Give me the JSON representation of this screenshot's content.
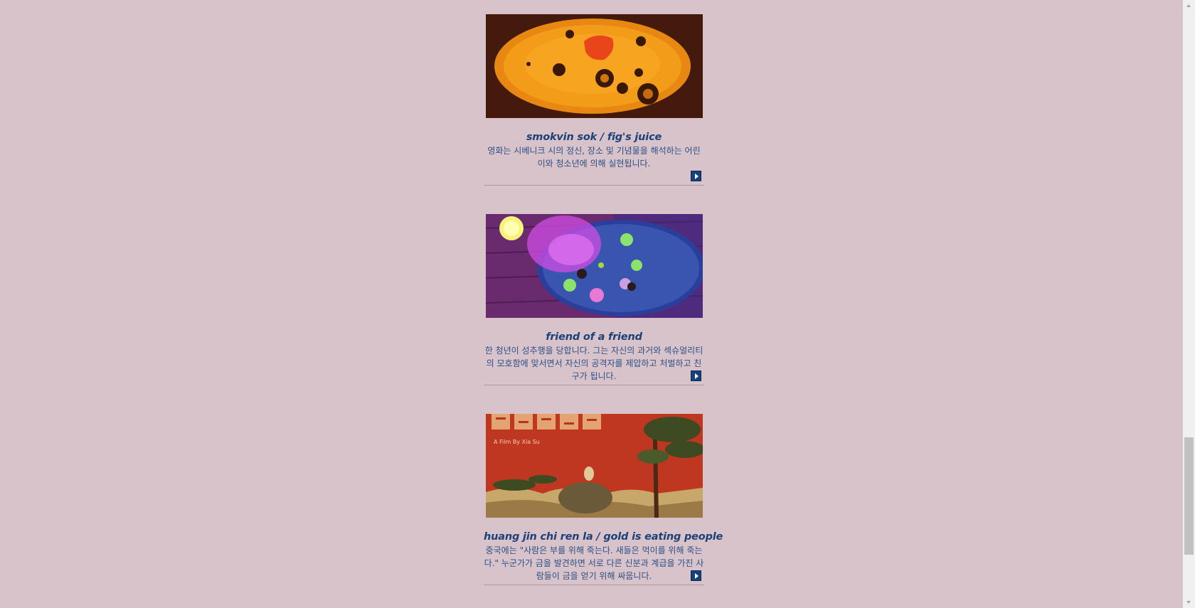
{
  "films": [
    {
      "title": "smokvin sok / fig's juice",
      "description": "영화는 시베니크 시의 정신, 장소 및 기념물을 해석하는 어린이와 청소년에 의해 실현됩니다.",
      "image": "orange-sand-animation-still",
      "more_icon": "play-arrow-icon"
    },
    {
      "title": "friend of a friend",
      "description": "한 청년이 성추행을 당합니다. 그는 자신의 과거와 섹슈얼리티의 모호함에 맞서면서 자신의 공격자를 제압하고 처벌하고 친구가 됩니다.",
      "image": "purple-room-animation-still",
      "more_icon": "play-arrow-icon"
    },
    {
      "title": "huang jin chi ren la / gold is eating people",
      "description": "중국에는 \"사람은 부를 위해 죽는다. 새들은 먹이를 위해 죽는다.\" 누군가가 금을 발견하면 서로 다른 신분과 계급을 가진 사람들이 금을 얻기 위해 싸웁니다.",
      "image": "red-chinese-painting-poster",
      "poster_text": "A Film By Xia Su",
      "more_icon": "play-arrow-icon"
    }
  ],
  "colors": {
    "background": "#d8c3cb",
    "title": "#1d4176",
    "text": "#2d4f86",
    "button": "#16427c"
  }
}
